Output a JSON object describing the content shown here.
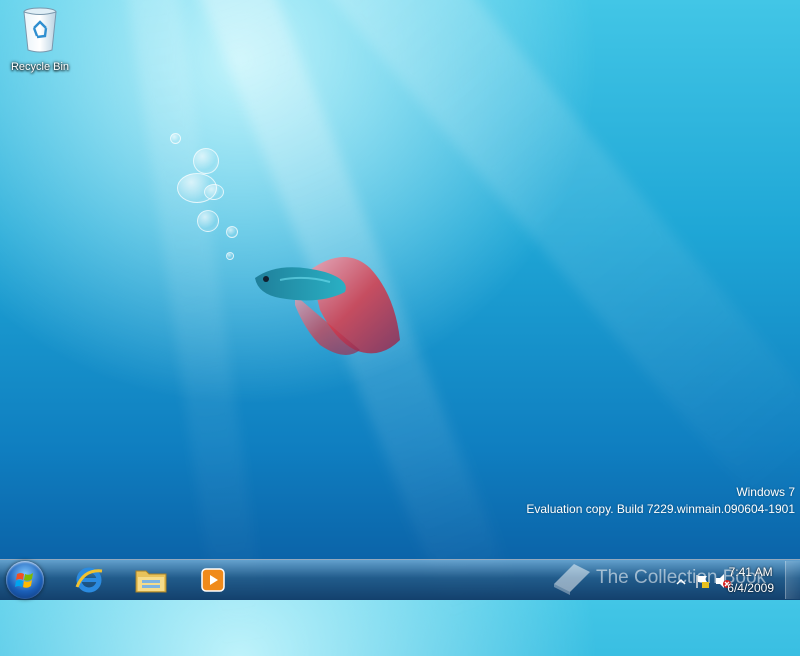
{
  "desktop": {
    "icons": [
      {
        "label": "Recycle Bin",
        "icon": "recycle-bin-icon"
      }
    ],
    "wallpaper": "betta-fish",
    "watermark": {
      "line1": "Windows 7",
      "line2": "Evaluation copy. Build 7229.winmain.090604-1901"
    }
  },
  "taskbar": {
    "start_icon": "windows-start-orb-icon",
    "pinned": [
      {
        "name": "internet-explorer",
        "icon": "internet-explorer-icon"
      },
      {
        "name": "windows-explorer",
        "icon": "folder-icon"
      },
      {
        "name": "windows-media-player",
        "icon": "media-player-icon"
      }
    ],
    "tray": {
      "overlay_text": "The Collection Book",
      "time": "7:41 AM",
      "date": "6/4/2009",
      "icons": [
        "show-hidden-icons-icon",
        "action-center-flag-icon",
        "volume-muted-icon"
      ]
    }
  },
  "colors": {
    "accent": "#1fa7d6",
    "fish_body": "#2aa0b0",
    "fish_fin": "#d83a4a"
  }
}
